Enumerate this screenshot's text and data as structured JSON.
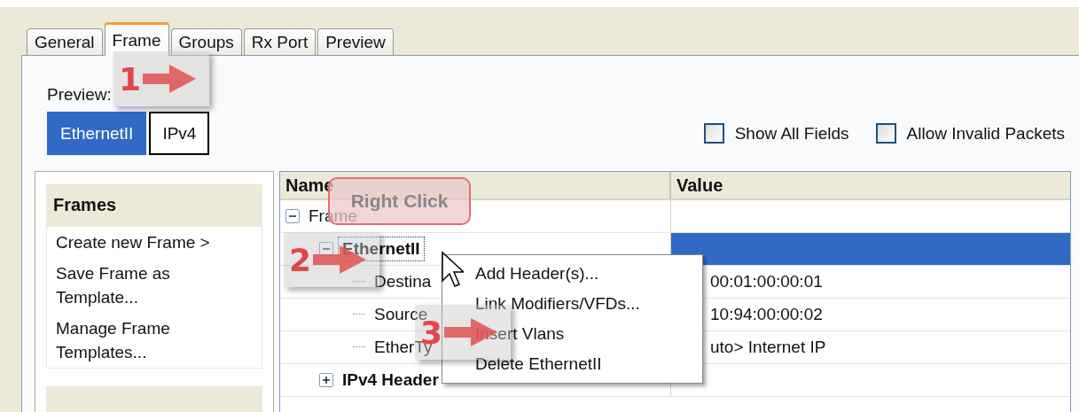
{
  "tabs": [
    {
      "label": "General",
      "selected": false
    },
    {
      "label": "Frame",
      "selected": true
    },
    {
      "label": "Groups",
      "selected": false
    },
    {
      "label": "Rx Port",
      "selected": false
    },
    {
      "label": "Preview",
      "selected": false
    }
  ],
  "preview": {
    "label": "Preview:",
    "options": [
      {
        "label": "EthernetII",
        "selected": true
      },
      {
        "label": "IPv4",
        "selected": false
      }
    ]
  },
  "options": [
    {
      "label": "Show All Fields",
      "checked": false
    },
    {
      "label": "Allow Invalid Packets",
      "checked": false
    }
  ],
  "sidebar": {
    "groups": [
      {
        "title": "Frames",
        "items": [
          "Create new Frame >",
          "Save Frame as Template...",
          "Manage Frame Templates..."
        ]
      }
    ]
  },
  "tree": {
    "columns": [
      "Name",
      "Value"
    ],
    "rows": [
      {
        "name": "Frame",
        "kind": "plain",
        "expanded": true,
        "selected": false,
        "children": [
          {
            "name": "EthernetII",
            "kind": "header",
            "expanded": true,
            "selected": true,
            "children": [
              {
                "name": "Destina",
                "value": "00:01:00:00:01",
                "kind": "plain",
                "selected": false
              },
              {
                "name": "Source",
                "value": "10:94:00:00:02",
                "kind": "plain",
                "selected": false
              },
              {
                "name": "EtherTy",
                "value": "uto> Internet IP",
                "kind": "plain",
                "selected": false
              }
            ]
          },
          {
            "name": "IPv4 Header",
            "kind": "header",
            "expanded": false,
            "selected": false
          }
        ]
      }
    ]
  },
  "context_menu": {
    "items": [
      "Add Header(s)...",
      "Link Modifiers/VFDs...",
      "Insert Vlans",
      "Delete EthernetII"
    ]
  },
  "annotations": [
    {
      "kind": "step",
      "label": "1"
    },
    {
      "kind": "step",
      "label": "2"
    },
    {
      "kind": "step",
      "label": "3"
    },
    {
      "kind": "bubble",
      "label": "Right Click"
    }
  ]
}
